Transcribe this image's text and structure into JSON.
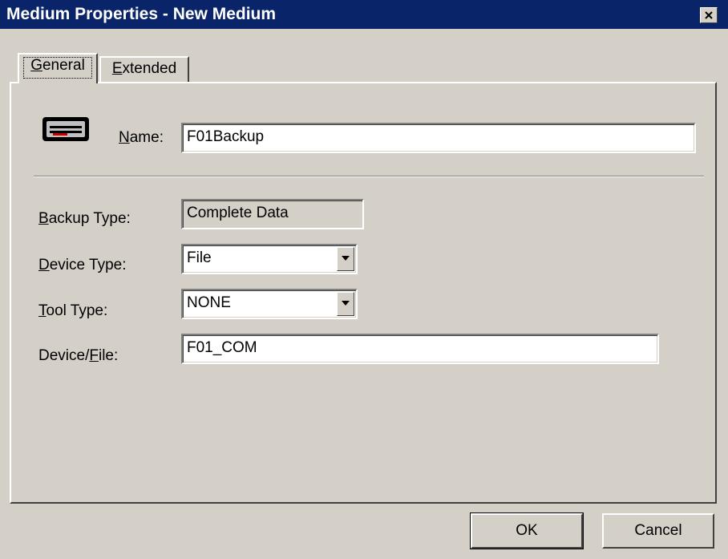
{
  "window": {
    "title": "Medium Properties - New Medium"
  },
  "tabs": [
    {
      "access_key": "G",
      "rest": "eneral",
      "selected": true
    },
    {
      "access_key": "E",
      "rest": "xtended",
      "selected": false
    }
  ],
  "general": {
    "icon": "tape-medium-icon",
    "name": {
      "pre": "",
      "key": "N",
      "post": "ame:",
      "value": "F01Backup"
    },
    "backup_type": {
      "pre": "",
      "key": "B",
      "post": "ackup Type:",
      "value": "Complete Data"
    },
    "device_type": {
      "pre": "",
      "key": "D",
      "post": "evice Type:",
      "value": "File"
    },
    "tool_type": {
      "pre": "",
      "key": "T",
      "post": "ool Type:",
      "value": "NONE"
    },
    "device_file": {
      "pre": "Device/",
      "key": "F",
      "post": "ile:",
      "value": "F01_COM"
    }
  },
  "buttons": {
    "ok": "OK",
    "cancel": "Cancel"
  },
  "colors": {
    "titlebar": "#0a246a",
    "face": "#d4d0c8"
  }
}
